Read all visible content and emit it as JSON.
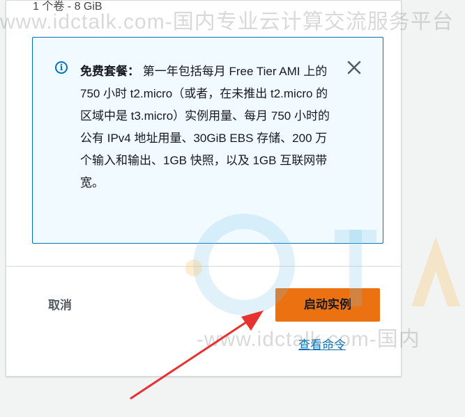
{
  "panel": {
    "volume_line": "1 个卷 - 8 GiB"
  },
  "info_box": {
    "title": "免费套餐：",
    "body": "第一年包括每月 Free Tier AMI 上的 750 小时 t2.micro（或者，在未推出 t2.micro 的区域中是 t3.micro）实例用量、每月 750 小时的公有 IPv4 地址用量、30GiB EBS 存储、200 万个输入和输出、1GB 快照，以及 1GB 互联网带宽。",
    "icon": "info-icon",
    "close_icon": "close-icon"
  },
  "actions": {
    "cancel_label": "取消",
    "launch_label": "启动实例",
    "view_command_label": "查看命令"
  },
  "watermarks": {
    "top": "www.idctalk.com-国内专业云计算交流服务平台",
    "mid": "-www.idctalk.com-国内"
  },
  "colors": {
    "accent_orange": "#ec7211",
    "info_blue": "#0073bb",
    "info_bg": "#f1faff",
    "annotation_red": "#e8322f"
  }
}
